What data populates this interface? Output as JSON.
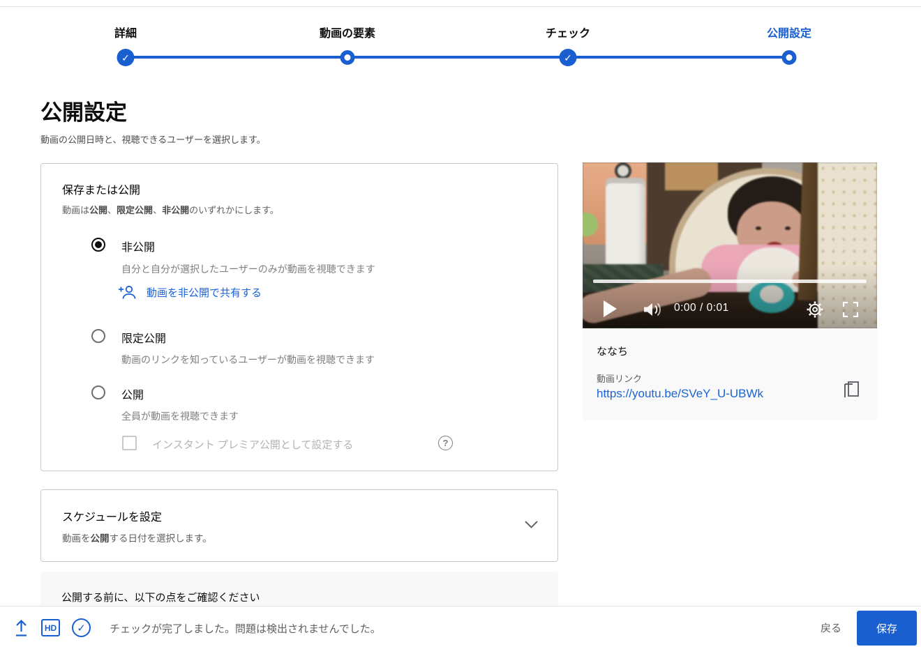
{
  "colors": {
    "accent": "#1a5fd0",
    "link": "#1b63d6",
    "text": "#0d0d0d",
    "muted": "#606060"
  },
  "stepper": {
    "steps": [
      {
        "label": "詳細",
        "state": "done"
      },
      {
        "label": "動画の要素",
        "state": "todo"
      },
      {
        "label": "チェック",
        "state": "done"
      },
      {
        "label": "公開設定",
        "state": "active"
      }
    ],
    "check_glyph": "✓"
  },
  "page": {
    "title": "公開設定",
    "subtitle": "動画の公開日時と、視聴できるユーザーを選択します。"
  },
  "visibility_card": {
    "heading": "保存または公開",
    "sub_prefix": "動画は",
    "sub_bold1": "公開",
    "sub_sep1": "、",
    "sub_bold2": "限定公開",
    "sub_sep2": "、",
    "sub_bold3": "非公開",
    "sub_suffix": "のいずれかにします。",
    "options": [
      {
        "label": "非公開",
        "description": "自分と自分が選択したユーザーのみが動画を視聴できます",
        "selected": true,
        "link_label": "動画を非公開で共有する"
      },
      {
        "label": "限定公開",
        "description": "動画のリンクを知っているユーザーが動画を視聴できます",
        "selected": false
      },
      {
        "label": "公開",
        "description": "全員が動画を視聴できます",
        "selected": false,
        "checkbox_label": "インスタント プレミア公開として設定する",
        "checkbox_checked": false,
        "help_glyph": "?"
      }
    ]
  },
  "schedule_card": {
    "title": "スケジュールを設定",
    "desc_prefix": "動画を",
    "desc_bold": "公開",
    "desc_suffix": "する日付を選択します。"
  },
  "checks_notice": {
    "text": "公開する前に、以下の点をご確認ください"
  },
  "player": {
    "time": "0:00 / 0:01"
  },
  "video_info": {
    "title": "ななち",
    "link_label": "動画リンク",
    "link_url": "https://youtu.be/SVeY_U-UBWk"
  },
  "footer": {
    "status": "チェックが完了しました。問題は検出されませんでした。",
    "hd_label": "HD",
    "back_label": "戻る",
    "save_label": "保存"
  }
}
